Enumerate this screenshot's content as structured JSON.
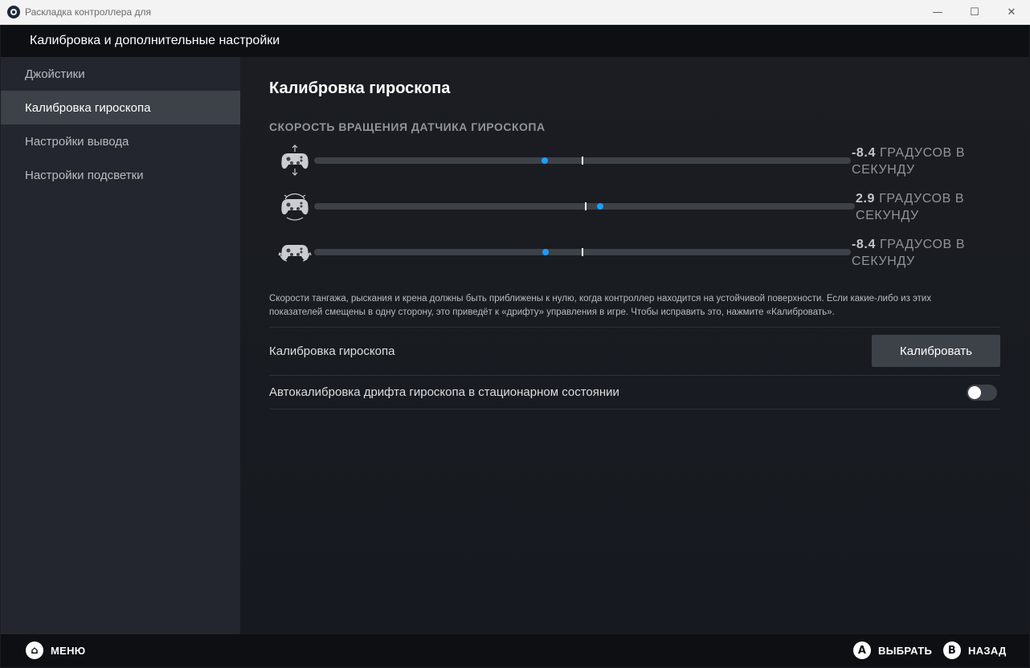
{
  "window": {
    "title": "Раскладка контроллера для",
    "minimize": "—",
    "maximize": "☐",
    "close": "✕"
  },
  "header": {
    "title": "Калибровка и дополнительные настройки"
  },
  "sidebar": {
    "items": [
      {
        "label": "Джойстики"
      },
      {
        "label": "Калибровка гироскопа"
      },
      {
        "label": "Настройки вывода"
      },
      {
        "label": "Настройки подсветки"
      }
    ],
    "active_index": 1
  },
  "main": {
    "title": "Калибровка гироскопа",
    "section_label": "СКОРОСТЬ ВРАЩЕНИЯ ДАТЧИКА ГИРОСКОПА",
    "axes": [
      {
        "icon": "gamepad-pitch-icon",
        "value": -8.4,
        "value_text": "-8.4",
        "unit_line1": "ГРАДУСОВ В",
        "unit_line2": "СЕКУНДУ"
      },
      {
        "icon": "gamepad-yaw-icon",
        "value": 2.9,
        "value_text": "2.9",
        "unit_line1": "ГРАДУСОВ В",
        "unit_line2": "СЕКУНДУ"
      },
      {
        "icon": "gamepad-roll-icon",
        "value": -8.4,
        "value_text": "-8.4",
        "unit_line1": "ГРАДУСОВ В",
        "unit_line2": "СЕКУНДУ"
      }
    ],
    "description": "Скорости тангажа, рыскания и крена должны быть приближены к нулю, когда контроллер находится на устойчивой поверхности. Если какие-либо из этих показателей смещены в одну сторону, это приведёт к «дрифту» управления в игре. Чтобы исправить это, нажмите «Калибровать».",
    "calibrate_row": {
      "label": "Калибровка гироскопа",
      "button_label": "Калибровать"
    },
    "auto_row": {
      "label": "Автокалибровка дрифта гироскопа в стационарном состоянии",
      "enabled": false
    }
  },
  "footer": {
    "menu": {
      "glyph": "⌂",
      "label": "МЕНЮ"
    },
    "select": {
      "glyph": "A",
      "label": "ВЫБРАТЬ"
    },
    "back": {
      "glyph": "B",
      "label": "НАЗАД"
    }
  },
  "colors": {
    "accent": "#1a9fff",
    "background": "#1b1d22",
    "sidebar": "#23262e",
    "active": "#3d4148"
  }
}
